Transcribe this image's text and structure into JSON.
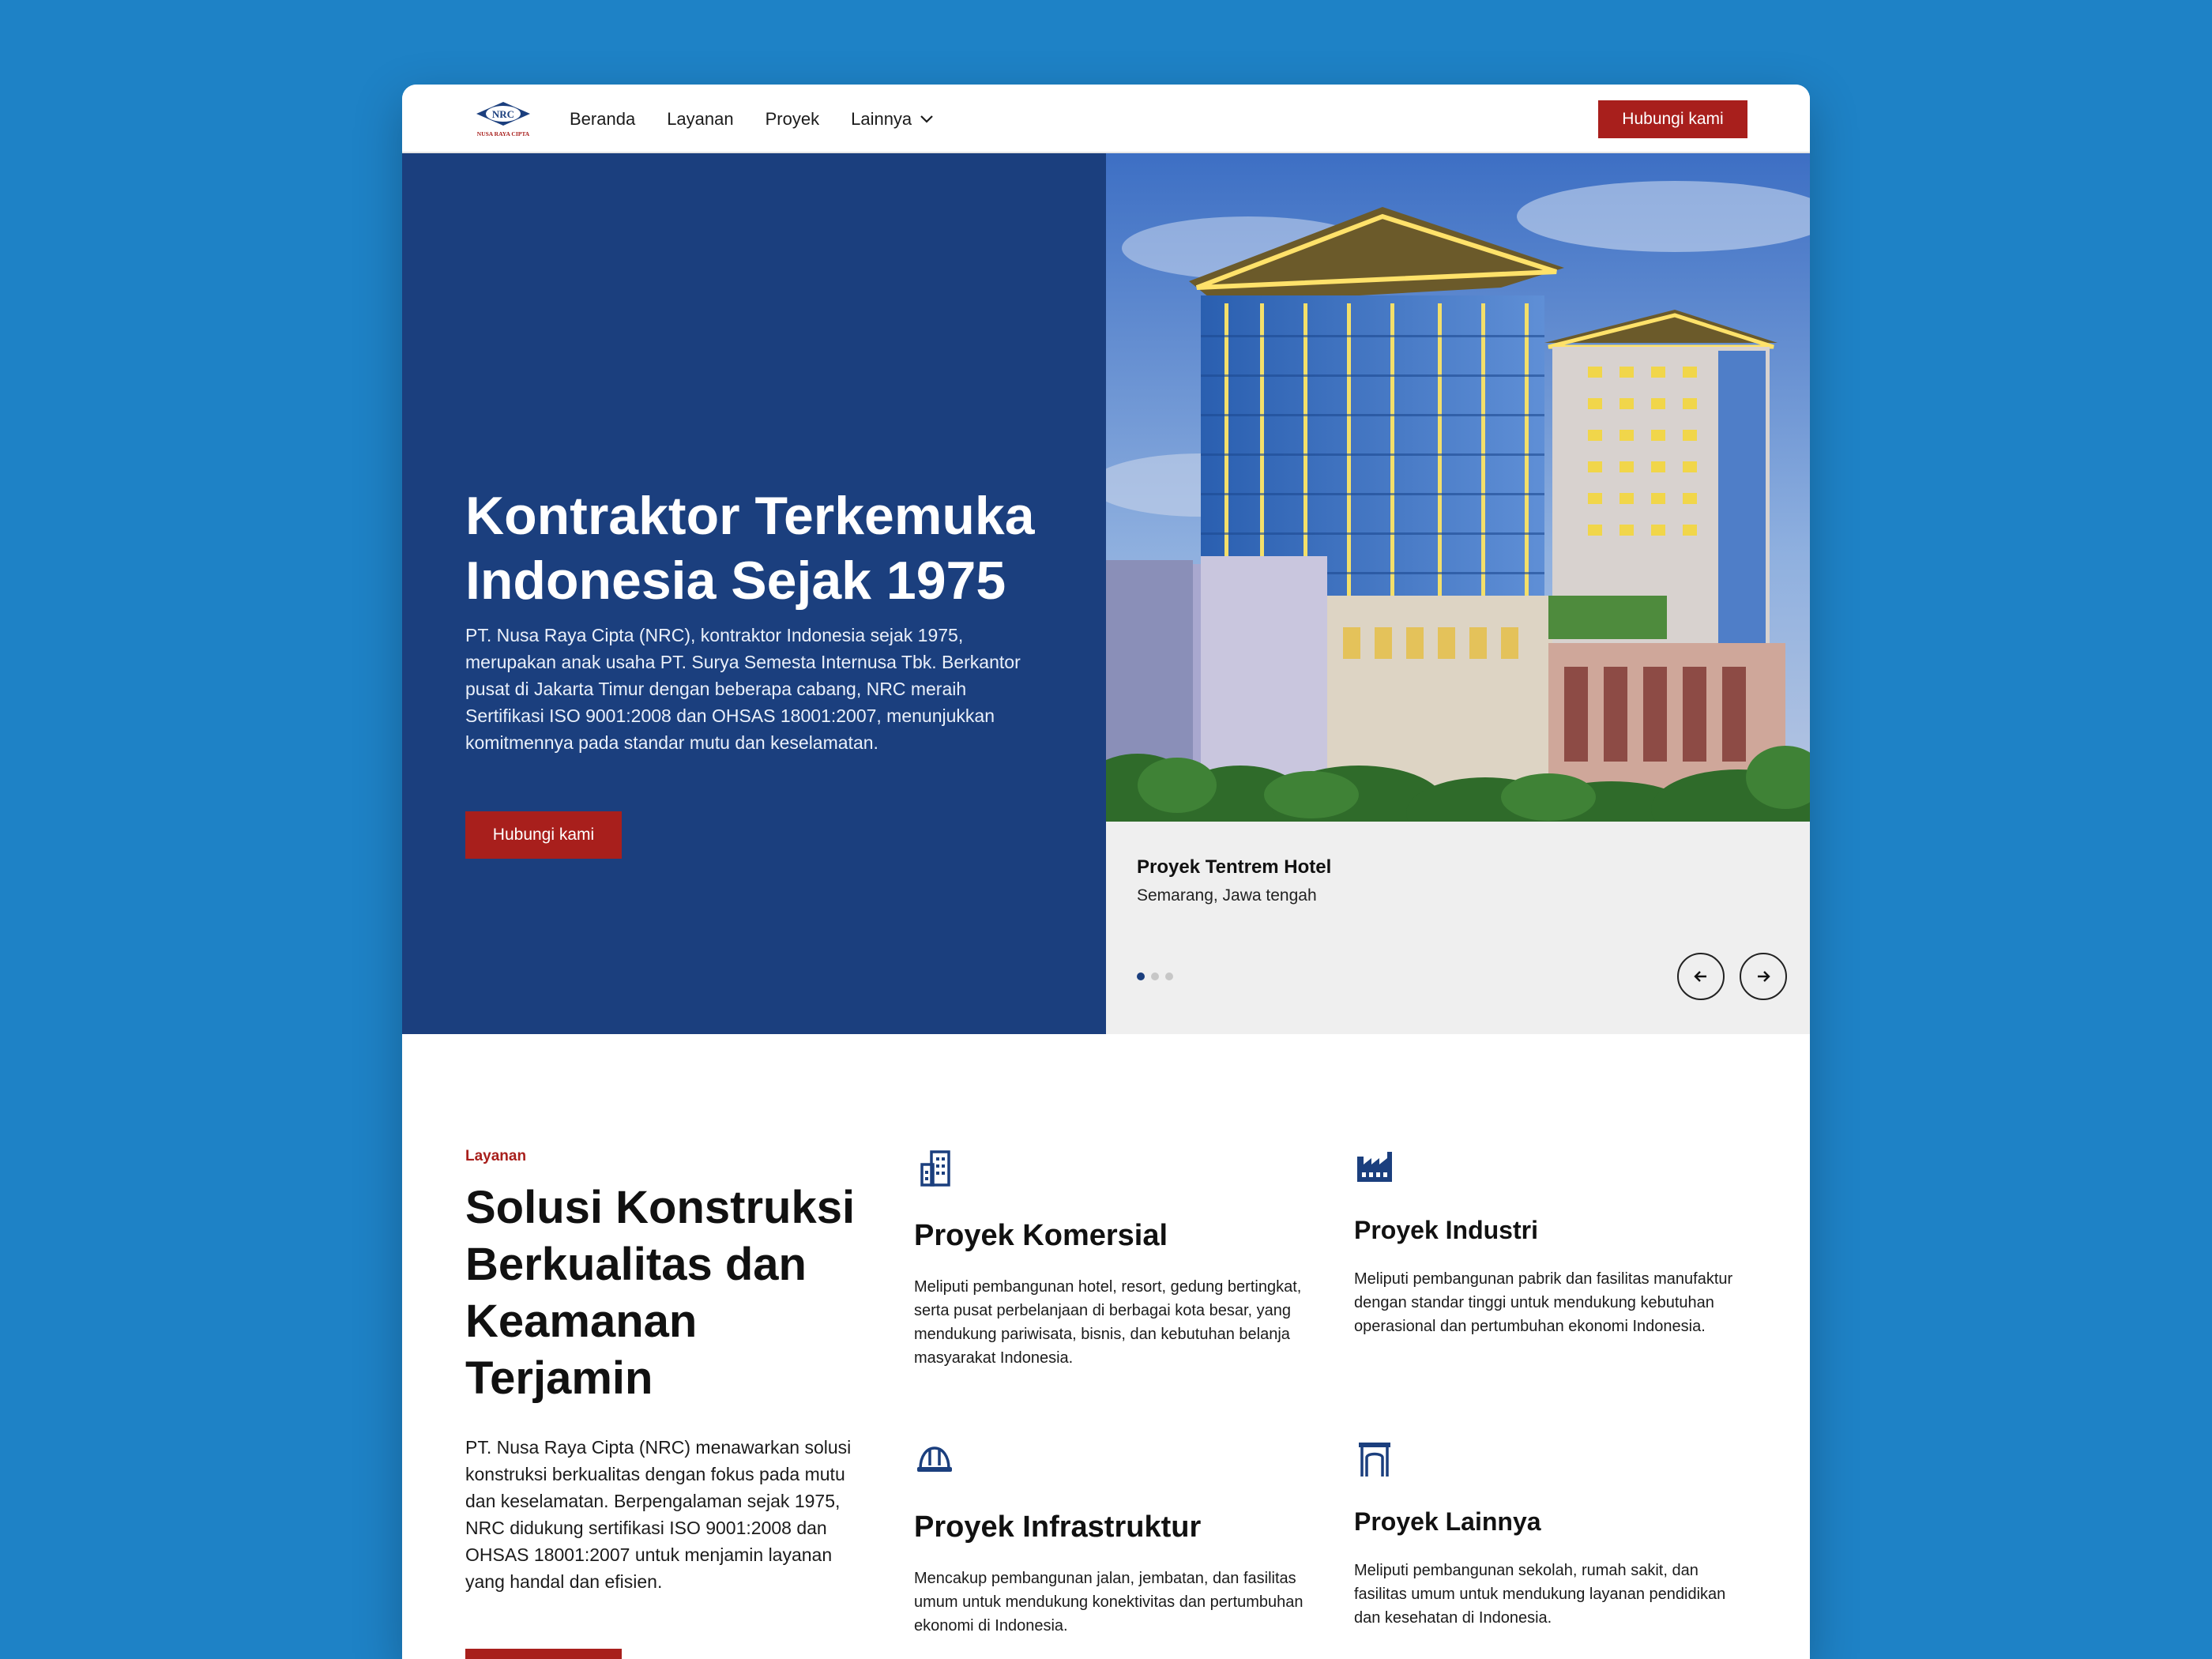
{
  "nav": {
    "logo_text": "NRC",
    "logo_caption": "NUSA RAYA CIPTA",
    "links": [
      "Beranda",
      "Layanan",
      "Proyek",
      "Lainnya"
    ],
    "cta": "Hubungi kami"
  },
  "hero": {
    "title": "Kontraktor Terkemuka Indonesia Sejak 1975",
    "description": "PT. Nusa Raya Cipta (NRC), kontraktor Indonesia sejak 1975, merupakan anak usaha PT. Surya Semesta Internusa Tbk. Berkantor pusat di Jakarta Timur dengan beberapa cabang, NRC meraih Sertifikasi ISO 9001:2008 dan OHSAS 18001:2007, menunjukkan komitmennya pada standar mutu dan keselamatan.",
    "cta": "Hubungi kami",
    "slide": {
      "title": "Proyek Tentrem Hotel",
      "location": "Semarang, Jawa tengah",
      "current": 1,
      "total": 3
    }
  },
  "services": {
    "eyebrow": "Layanan",
    "title": "Solusi Konstruksi Berkualitas dan Keamanan Terjamin",
    "description": "PT. Nusa Raya Cipta (NRC) menawarkan solusi konstruksi berkualitas dengan fokus pada mutu dan keselamatan. Berpengalaman sejak 1975, NRC didukung sertifikasi ISO 9001:2008 dan OHSAS 18001:2007 untuk menjamin layanan yang handal dan efisien.",
    "items": [
      {
        "title": "Proyek Komersial",
        "icon": "office-building-icon",
        "description": "Meliputi pembangunan hotel, resort, gedung bertingkat, serta pusat perbelanjaan di berbagai kota besar, yang mendukung pariwisata, bisnis, dan kebutuhan belanja masyarakat Indonesia."
      },
      {
        "title": "Proyek Industri",
        "icon": "factory-icon",
        "description": "Meliputi pembangunan pabrik dan fasilitas manufaktur dengan standar tinggi untuk mendukung kebutuhan operasional dan pertumbuhan ekonomi Indonesia."
      },
      {
        "title": "Proyek Infrastruktur",
        "icon": "hard-hat-icon",
        "description": "Mencakup pembangunan jalan, jembatan, dan fasilitas umum untuk mendukung konektivitas dan pertumbuhan ekonomi di Indonesia."
      },
      {
        "title": "Proyek Lainnya",
        "icon": "gate-icon",
        "description": "Meliputi pembangunan sekolah, rumah sakit, dan fasilitas umum untuk mendukung layanan pendidikan dan kesehatan di Indonesia."
      }
    ]
  },
  "colors": {
    "primary": "#1b3f7e",
    "accent": "#a81f1c",
    "background": "#1e82c6"
  }
}
